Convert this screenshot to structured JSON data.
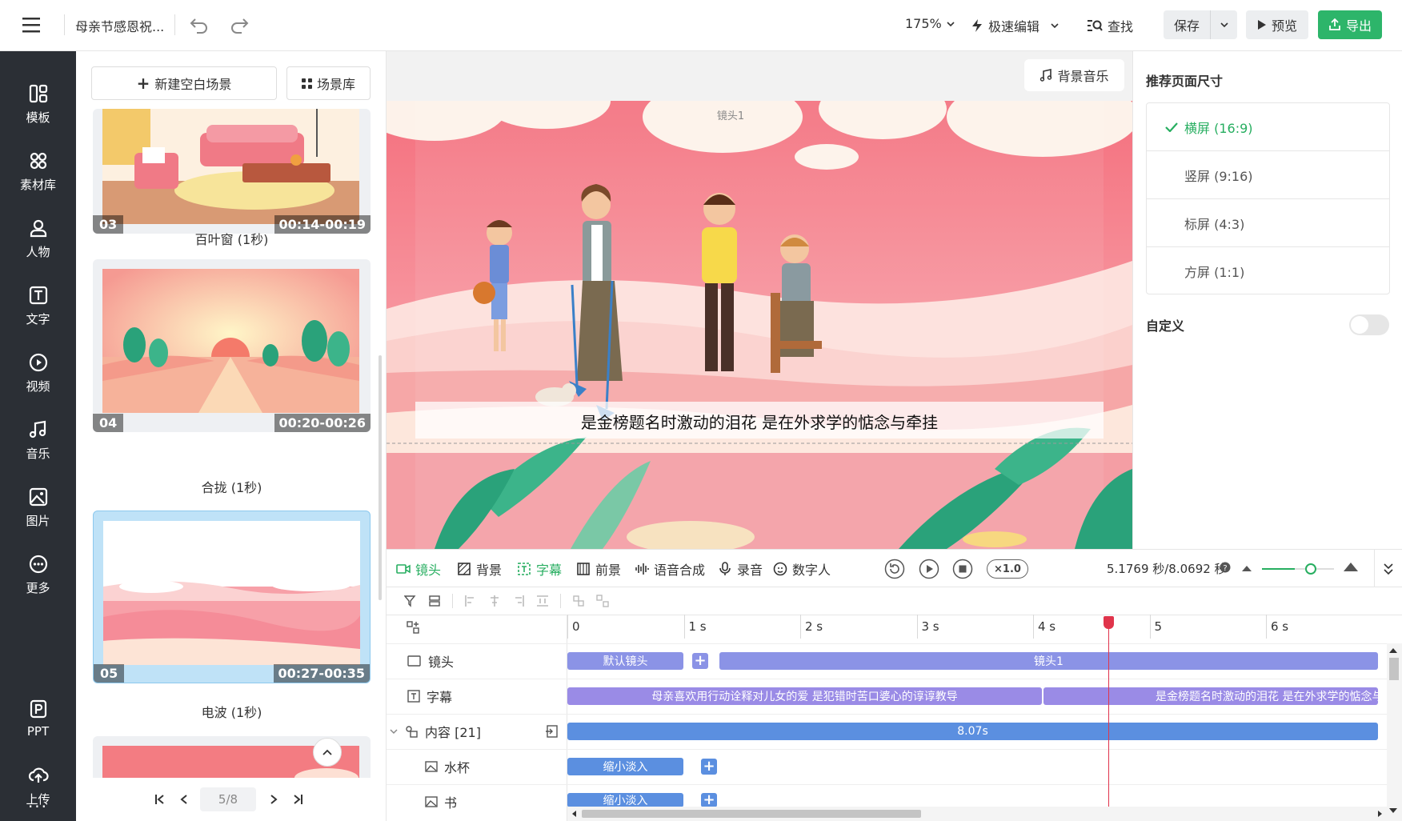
{
  "colors": {
    "accent": "#27ae60",
    "rail": "#2b2f35",
    "clip": "#8b93e6",
    "clip_blue": "#5b8fe0",
    "playhead": "#e0344b"
  },
  "topbar": {
    "menu_icon": "hamburger-icon",
    "title": "母亲节感恩祝...",
    "zoom": "175%",
    "mode": "极速编辑",
    "find": "查找",
    "save": "保存",
    "preview": "预览",
    "export": "导出"
  },
  "rail": {
    "items": [
      {
        "label": "模板",
        "icon": "template-icon"
      },
      {
        "label": "素材库",
        "icon": "assets-icon"
      },
      {
        "label": "人物",
        "icon": "person-icon"
      },
      {
        "label": "文字",
        "icon": "text-icon"
      },
      {
        "label": "视频",
        "icon": "video-icon"
      },
      {
        "label": "音乐",
        "icon": "music-icon"
      },
      {
        "label": "图片",
        "icon": "image-icon"
      },
      {
        "label": "更多",
        "icon": "more-icon"
      },
      {
        "label": "PPT",
        "icon": "ppt-icon"
      },
      {
        "label": "上传",
        "icon": "upload-icon"
      }
    ],
    "bottom_more": "···"
  },
  "scenes": {
    "new_blank": "新建空白场景",
    "library": "场景库",
    "cards": [
      {
        "num": "03",
        "time": "00:14-00:19",
        "name": "百叶窗 (1秒)"
      },
      {
        "num": "04",
        "time": "00:20-00:26",
        "name": "合拢 (1秒)"
      },
      {
        "num": "05",
        "time": "00:27-00:35",
        "name": "电波 (1秒)"
      }
    ],
    "pager": "5/8"
  },
  "canvas": {
    "bg_music": "背景音乐",
    "shot_label": "镜头1",
    "subtitle": "是金榜题名时激动的泪花 是在外求学的惦念与牵挂"
  },
  "right": {
    "title": "推荐页面尺寸",
    "options": [
      {
        "label": "横屏 (16:9)",
        "selected": true
      },
      {
        "label": "竖屏 (9:16)",
        "selected": false
      },
      {
        "label": "标屏 (4:3)",
        "selected": false
      },
      {
        "label": "方屏 (1:1)",
        "selected": false
      }
    ],
    "custom": "自定义"
  },
  "tools": {
    "items": [
      {
        "label": "镜头",
        "active": true
      },
      {
        "label": "背景",
        "active": false
      },
      {
        "label": "字幕",
        "active": true
      },
      {
        "label": "前景",
        "active": false
      },
      {
        "label": "语音合成",
        "active": false
      },
      {
        "label": "录音",
        "active": false
      },
      {
        "label": "数字人",
        "active": false
      }
    ],
    "speed": "×1.0",
    "time": "5.1769 秒/8.0692 秒",
    "zoom_level": 0.45
  },
  "timeline": {
    "ticks": [
      "0",
      "1 s",
      "2 s",
      "3 s",
      "4 s",
      "5",
      "6 s"
    ],
    "tracks": [
      {
        "label": "镜头"
      },
      {
        "label": "字幕"
      },
      {
        "label": "内容 [21]"
      },
      {
        "label": "水杯"
      },
      {
        "label": "书"
      }
    ],
    "clips": {
      "default_shot": "默认镜头",
      "shot1": "镜头1",
      "sub1": "母亲喜欢用行动诠释对儿女的爱  是犯错时苦口婆心的谆谆教导",
      "sub2": "是金榜题名时激动的泪花 是在外求学的惦念与牵挂",
      "content": "8.07s",
      "cup": "缩小淡入",
      "book": "缩小淡入"
    },
    "playhead_seconds": 5.18
  }
}
